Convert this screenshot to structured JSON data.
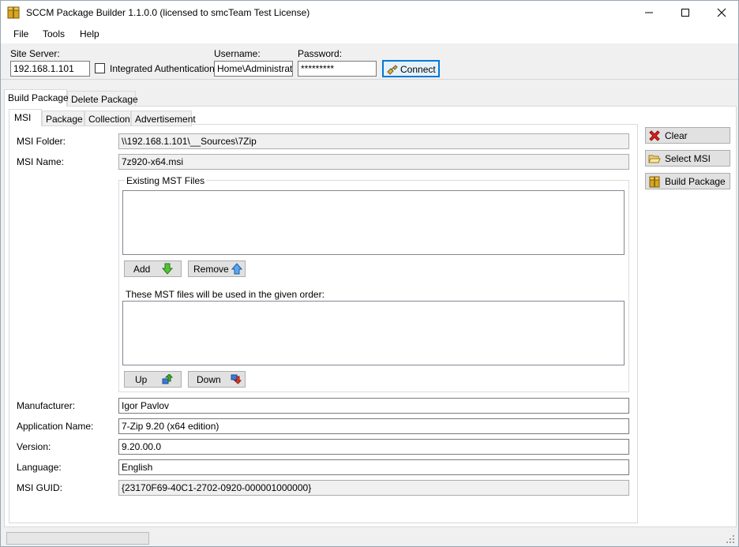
{
  "window": {
    "title": "SCCM Package Builder 1.1.0.0 (licensed to smcTeam Test License)"
  },
  "menu": {
    "file": "File",
    "tools": "Tools",
    "help": "Help"
  },
  "connection": {
    "site_server_label": "Site Server:",
    "site_server_value": "192.168.1.101",
    "integrated_auth_label": "Integrated Authentication",
    "integrated_auth_checked": false,
    "username_label": "Username:",
    "username_value": "Home\\Administrator",
    "password_label": "Password:",
    "password_value": "*********",
    "connect_label": "Connect"
  },
  "main_tabs": [
    {
      "label": "Build Package",
      "active": true
    },
    {
      "label": "Delete Package",
      "active": false
    }
  ],
  "sub_tabs": [
    {
      "label": "MSI",
      "active": true
    },
    {
      "label": "Package",
      "active": false
    },
    {
      "label": "Collection",
      "active": false
    },
    {
      "label": "Advertisement",
      "active": false
    }
  ],
  "msi": {
    "folder_label": "MSI Folder:",
    "folder_value": "\\\\192.168.1.101\\__Sources\\7Zip",
    "name_label": "MSI Name:",
    "name_value": "7z920-x64.msi",
    "mst_group_title": "Existing MST Files",
    "add_label": "Add",
    "remove_label": "Remove",
    "order_label": "These MST files will be used in the given order:",
    "up_label": "Up",
    "down_label": "Down",
    "manufacturer_label": "Manufacturer:",
    "manufacturer_value": "Igor Pavlov",
    "app_name_label": "Application Name:",
    "app_name_value": "7-Zip 9.20 (x64 edition)",
    "version_label": "Version:",
    "version_value": "9.20.00.0",
    "language_label": "Language:",
    "language_value": "English",
    "guid_label": "MSI GUID:",
    "guid_value": "{23170F69-40C1-2702-0920-000001000000}"
  },
  "actions": {
    "clear_label": "Clear",
    "select_msi_label": "Select MSI",
    "build_package_label": "Build Package"
  },
  "status": {
    "progress": 0
  },
  "icons": {
    "app": "package-icon",
    "connect": "connect-icon",
    "add": "arrow-down-green-icon",
    "remove": "arrow-up-blue-icon",
    "up": "move-up-icon",
    "down": "move-down-icon",
    "clear": "red-x-icon",
    "select_msi": "folder-open-icon",
    "build": "package-build-icon"
  }
}
